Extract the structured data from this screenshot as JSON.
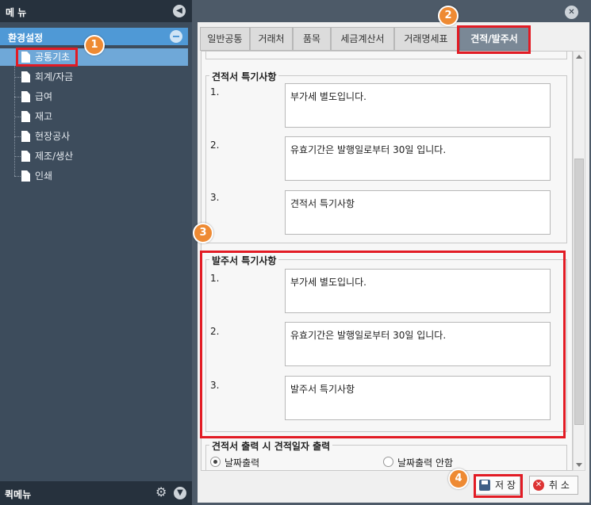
{
  "sidebar": {
    "header": "메 뉴",
    "group_label": "환경설정",
    "items": [
      {
        "label": "공통기초"
      },
      {
        "label": "회계/자금"
      },
      {
        "label": "급여"
      },
      {
        "label": "재고"
      },
      {
        "label": "현장공사"
      },
      {
        "label": "제조/생산"
      },
      {
        "label": "인쇄"
      }
    ],
    "footer": "퀵메뉴"
  },
  "tabs": [
    {
      "label": "일반공통"
    },
    {
      "label": "거래처"
    },
    {
      "label": "품목"
    },
    {
      "label": "세금계산서"
    },
    {
      "label": "거래명세표"
    },
    {
      "label": "견적/발주서"
    }
  ],
  "quote_section": {
    "title": "견적서 특기사항",
    "rows": [
      {
        "num": "1.",
        "text": "부가세 별도입니다."
      },
      {
        "num": "2.",
        "text": "유효기간은 발행일로부터 30일 입니다."
      },
      {
        "num": "3.",
        "text": "견적서 특기사항"
      }
    ]
  },
  "order_section": {
    "title": "발주서 특기사항",
    "rows": [
      {
        "num": "1.",
        "text": "부가세 별도입니다."
      },
      {
        "num": "2.",
        "text": "유효기간은 발행일로부터 30일 입니다."
      },
      {
        "num": "3.",
        "text": "발주서 특기사항"
      }
    ]
  },
  "date_output": {
    "title": "견적서 출력 시 견적일자 출력",
    "options": [
      {
        "label": "날짜출력",
        "selected": true
      },
      {
        "label": "날짜출력 안함",
        "selected": false
      }
    ]
  },
  "buttons": {
    "save": "저 장",
    "cancel": "취 소"
  },
  "markers": [
    "1",
    "2",
    "3",
    "4"
  ],
  "colors": {
    "highlight": "#e21b24",
    "marker": "#ee8a33",
    "active_tab": "#7a8896",
    "selected_group": "#4f99d6"
  }
}
